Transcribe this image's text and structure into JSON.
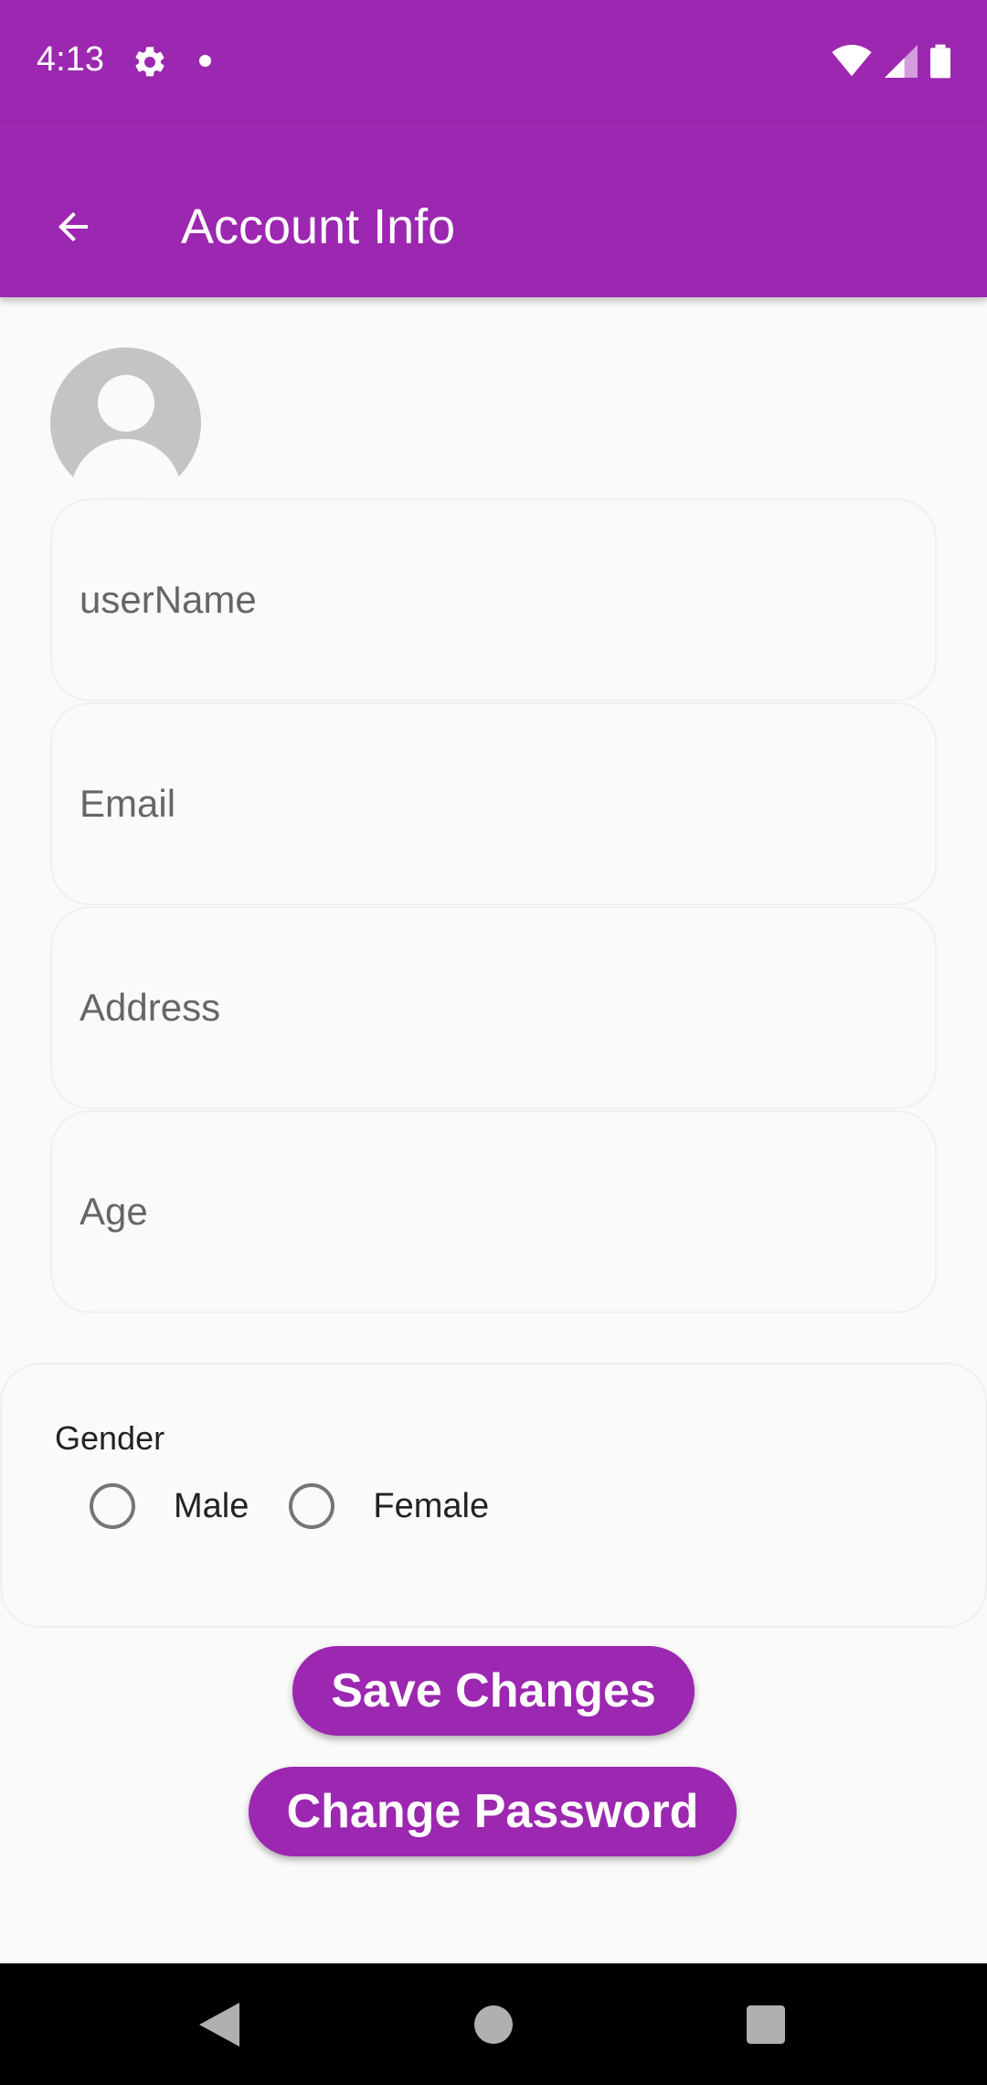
{
  "status_bar": {
    "time": "4:13",
    "icons": [
      "gear-icon",
      "notification-dot-icon",
      "wifi-icon",
      "signal-icon",
      "battery-icon"
    ]
  },
  "app_bar": {
    "title": "Account Info",
    "back_icon": "arrow-back-icon",
    "color": "#9c27b0"
  },
  "form": {
    "avatar_icon": "person-avatar-icon",
    "fields": [
      {
        "placeholder": "userName",
        "value": ""
      },
      {
        "placeholder": "Email",
        "value": ""
      },
      {
        "placeholder": "Address",
        "value": ""
      },
      {
        "placeholder": "Age",
        "value": ""
      }
    ],
    "gender": {
      "label": "Gender",
      "options": [
        {
          "label": "Male",
          "selected": false
        },
        {
          "label": "Female",
          "selected": false
        }
      ]
    }
  },
  "actions": {
    "save_label": "Save Changes",
    "change_password_label": "Change Password"
  },
  "nav_bar": {
    "icons": [
      "back-triangle-icon",
      "home-circle-icon",
      "recents-square-icon"
    ]
  }
}
